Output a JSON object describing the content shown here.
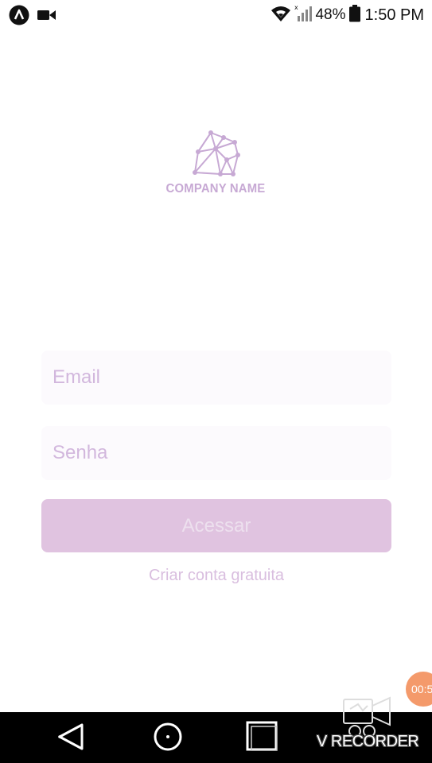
{
  "status_bar": {
    "battery": "48%",
    "time": "1:50 PM",
    "icons": [
      "app-notification-icon",
      "video-camera-icon",
      "wifi-icon",
      "signal-icon",
      "battery-icon"
    ]
  },
  "logo": {
    "name": "COMPANY NAME",
    "icon": "network-polygon-logo-icon"
  },
  "form": {
    "email_placeholder": "Email",
    "email_value": "",
    "password_placeholder": "Senha",
    "password_value": "",
    "submit_label": "Acessar",
    "create_account_label": "Criar conta gratuita"
  },
  "recorder": {
    "timer": "00:5",
    "watermark": "V RECORDER"
  },
  "navigation": {
    "icons": [
      "back-icon",
      "home-icon",
      "recent-apps-icon"
    ]
  },
  "colors": {
    "accent": "#c7a9d4",
    "button_bg": "#e0c3e0",
    "button_text": "#ede0ee",
    "placeholder": "#d2b7dd",
    "link": "#d9bedf",
    "field_bg": "#fcfafd",
    "timer_bg": "#f49a6b",
    "nav_bg": "#000000"
  }
}
